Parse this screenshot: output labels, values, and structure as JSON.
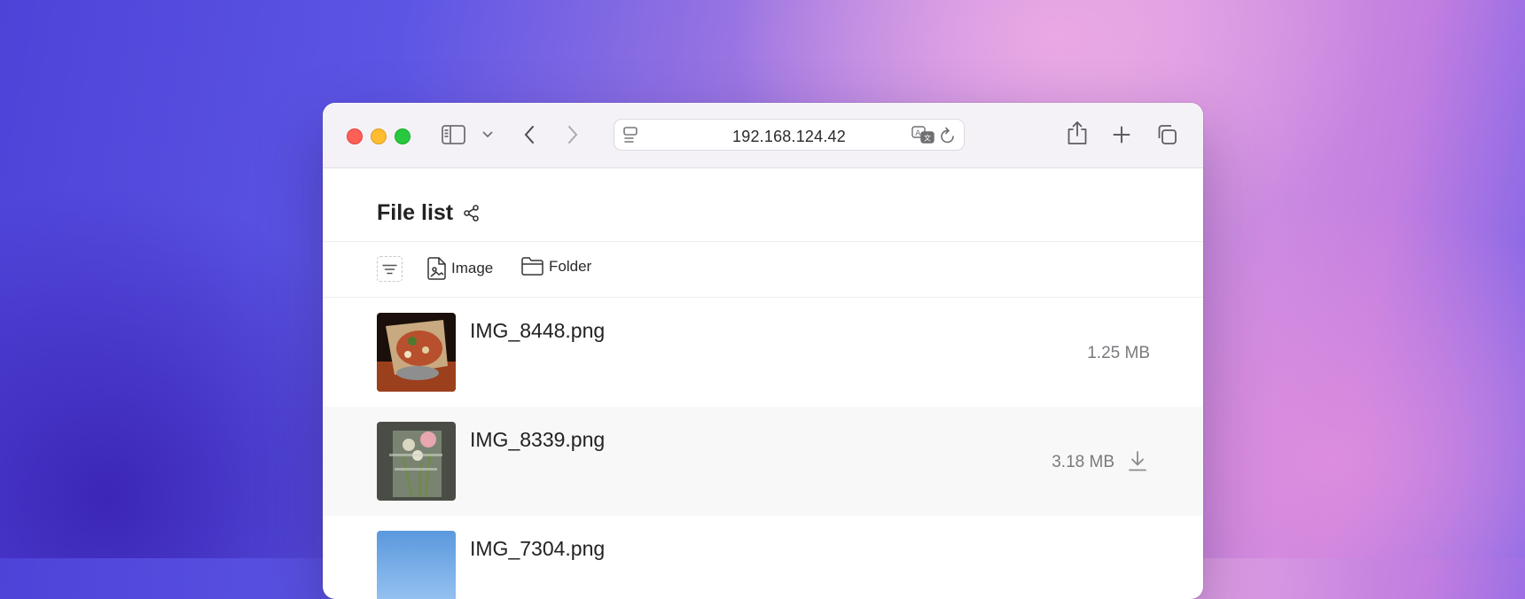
{
  "browser": {
    "url": "192.168.124.42",
    "icons": {
      "sidebar": "sidebar-icon",
      "tab_dropdown": "chevron-down-icon",
      "back": "chevron-left-icon",
      "forward": "chevron-right-icon",
      "reader": "page-menu-icon",
      "translate": "translate-icon",
      "reload": "reload-icon",
      "share": "share-icon",
      "new_tab": "plus-icon",
      "tab_overview": "tabs-icon"
    }
  },
  "page": {
    "title": "File list",
    "toolbar": {
      "filter_icon": "filter-icon",
      "chips": [
        {
          "label": "Image",
          "icon": "image-file-icon"
        },
        {
          "label": "Folder",
          "icon": "folder-icon"
        }
      ]
    },
    "files": [
      {
        "name": "IMG_8448.png",
        "size": "1.25 MB",
        "thumb_colors": [
          "#8a3a1e",
          "#c7a77a"
        ]
      },
      {
        "name": "IMG_8339.png",
        "size": "3.18 MB",
        "thumb_colors": [
          "#3d4038",
          "#a8b39a"
        ],
        "download_icon": "download-icon"
      },
      {
        "name": "IMG_7304.png",
        "size": "",
        "thumb_colors": [
          "#5e9be0",
          "#8cbcf0"
        ]
      }
    ]
  }
}
